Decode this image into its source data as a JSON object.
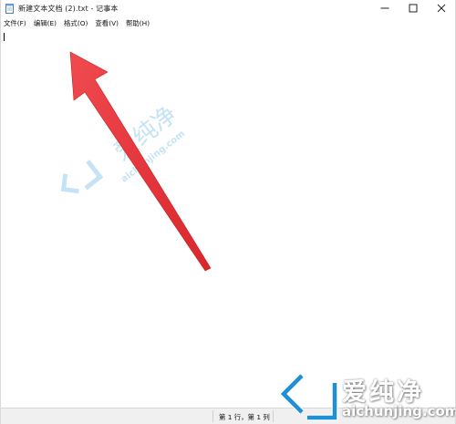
{
  "window": {
    "title": "新建文本文档 (2).txt - 记事本",
    "controls": [
      "minimize-icon",
      "maximize-icon",
      "close-icon"
    ]
  },
  "menubar": {
    "items": [
      {
        "label": "文件(F)"
      },
      {
        "label": "编辑(E)"
      },
      {
        "label": "格式(O)"
      },
      {
        "label": "查看(V)"
      },
      {
        "label": "帮助(H)"
      }
    ]
  },
  "editor": {
    "content": ""
  },
  "statusbar": {
    "position": "第 1 行，第 1 列"
  },
  "annotation": {
    "arrow_color": "#e8383d"
  },
  "watermark": {
    "brand_cn": "爱纯净",
    "brand_en": "aichunjing.com",
    "color": "#7fc3ea"
  }
}
